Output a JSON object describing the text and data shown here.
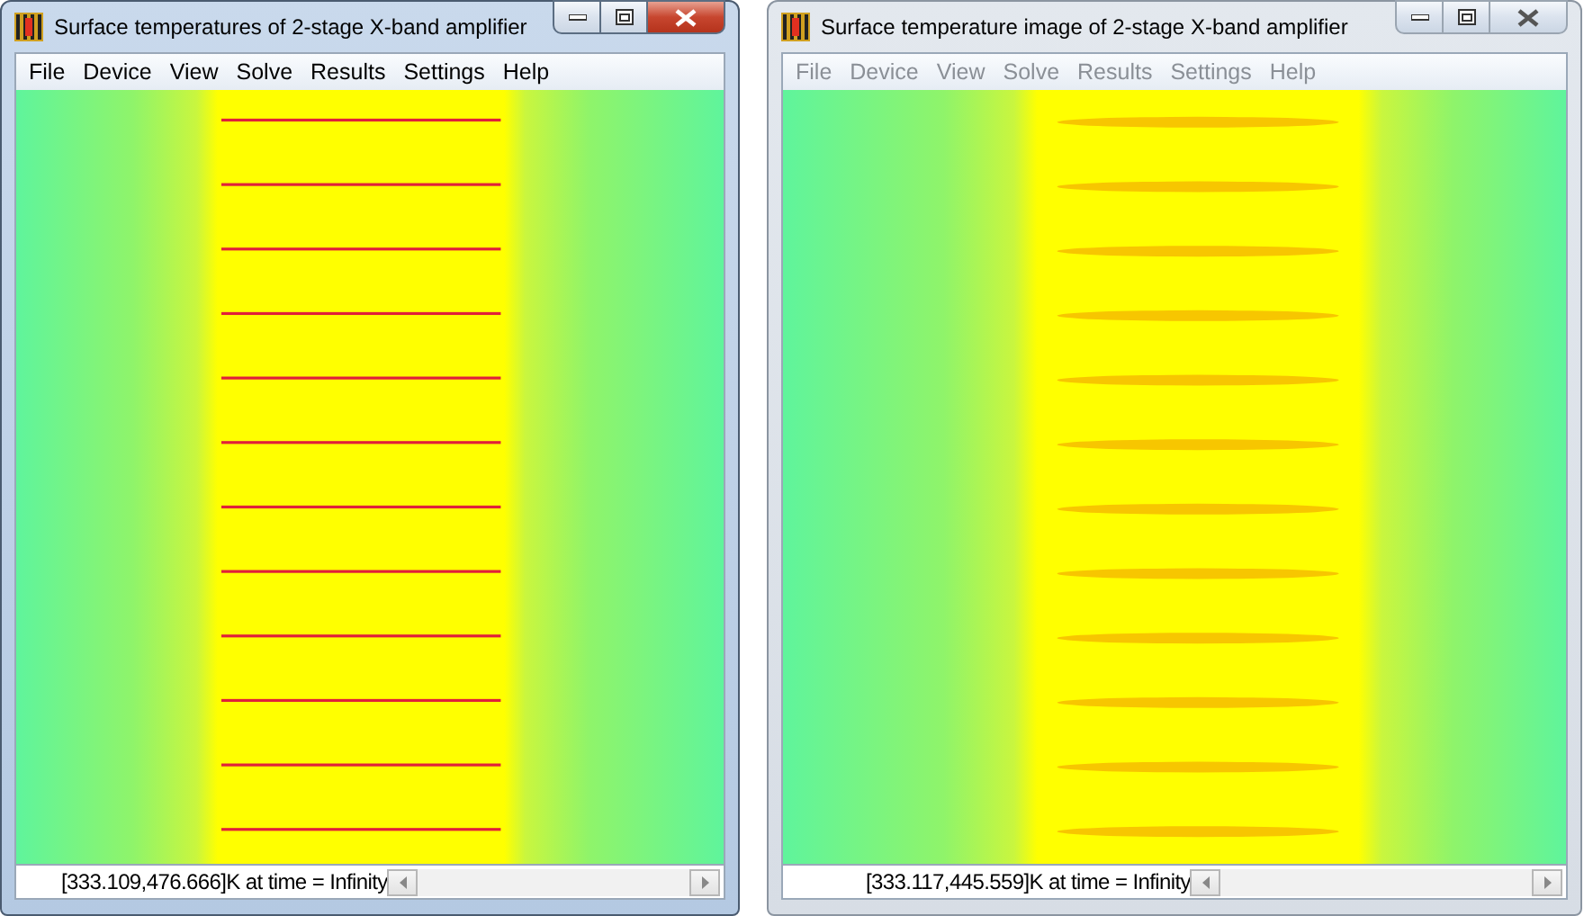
{
  "windows": [
    {
      "title": "Surface temperatures of 2-stage X-band amplifier",
      "active": true,
      "menu": [
        "File",
        "Device",
        "View",
        "Solve",
        "Results",
        "Settings",
        "Help"
      ],
      "image": {
        "kind": "lines"
      },
      "status": "[333.109,476.666]K at time = Infinity"
    },
    {
      "title": "Surface temperature image of 2-stage X-band amplifier",
      "active": false,
      "menu": [
        "File",
        "Device",
        "View",
        "Solve",
        "Results",
        "Settings",
        "Help"
      ],
      "image": {
        "kind": "blurred"
      },
      "status": "[333.117,445.559]K at time = Infinity"
    }
  ]
}
